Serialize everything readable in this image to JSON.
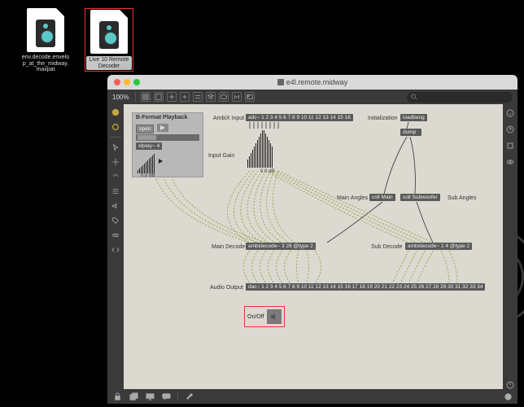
{
  "desktop": {
    "files": [
      {
        "name": "env.decode.envelop_at_the_midway.maxpat",
        "selected": false
      },
      {
        "name": "Live 10 Remote Decoder",
        "selected": true
      }
    ]
  },
  "window": {
    "title": "e4l.remote.midway",
    "zoom": "100%",
    "search_placeholder": ""
  },
  "patch": {
    "panel_bformat": {
      "title": "B-Format Playback"
    },
    "open_btn": "open",
    "sfplay": "sfplay~ 4",
    "gain_db": "0.0 dB",
    "ambix_label": "AmbiX Input",
    "adc_obj": "adc~ 1 2 3 4 5 6 7 8 9 10 11 12 13 14 15 16",
    "input_gain_label": "Input Gain",
    "input_gain_db": "0.0 dB",
    "init_label": "Initialization",
    "loadbang": "loadbang",
    "dump": "dump",
    "main_angles": "Main Angles",
    "sub_angles": "Sub Angles",
    "coll_main": "coll Main",
    "coll_sub": "coll Subwoofer",
    "main_decode_label": "Main Decode",
    "main_decode_obj": "ambidecode~ 3 28 @type 2",
    "sub_decode_label": "Sub Decode",
    "sub_decode_obj": "ambidecode~ 1 4 @type 2",
    "audio_output_label": "Audio Output",
    "dac_obj": "dac~ 1 2 3 4 5 6 7 8 9 10 11 12 13 14 15 16 17 18 19 20 21 22 23 24 25 26 27 28 29 30 31 32 33 34",
    "onoff_label": "On/Off"
  },
  "colors": {
    "highlight": "#e33333",
    "canvas_bg": "#dcd9d0"
  }
}
